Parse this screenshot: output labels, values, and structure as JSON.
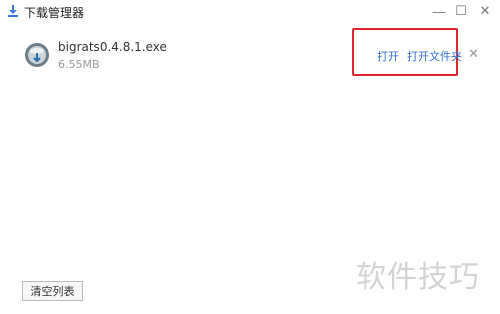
{
  "window": {
    "title": "下载管理器",
    "controls": {
      "minimize": "—",
      "maximize": "☐",
      "close": "✕"
    }
  },
  "download": {
    "file_name": "bigrats0.4.8.1.exe",
    "file_size": "6.55MB",
    "actions": {
      "open": "打开",
      "open_folder": "打开文件夹",
      "remove": "✕"
    }
  },
  "footer": {
    "clear_list": "清空列表"
  },
  "watermark": "软件技巧",
  "colors": {
    "link": "#2f6fd1",
    "highlight": "#e0262c",
    "download_icon": "#3b7dd8"
  },
  "icons": {
    "app": "download-arrow-icon",
    "file": "disc-file-icon"
  }
}
